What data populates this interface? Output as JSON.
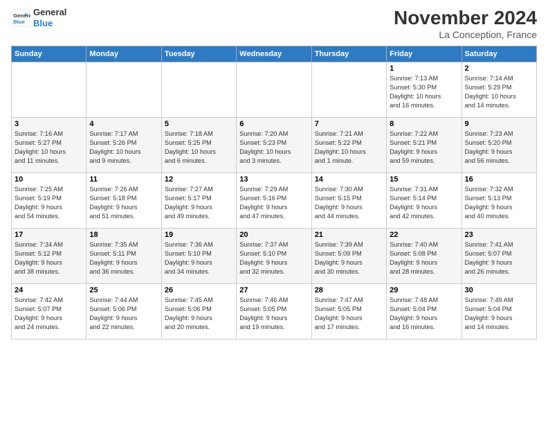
{
  "logo": {
    "line1": "General",
    "line2": "Blue"
  },
  "title": "November 2024",
  "location": "La Conception, France",
  "days_of_week": [
    "Sunday",
    "Monday",
    "Tuesday",
    "Wednesday",
    "Thursday",
    "Friday",
    "Saturday"
  ],
  "weeks": [
    [
      {
        "day": "",
        "info": ""
      },
      {
        "day": "",
        "info": ""
      },
      {
        "day": "",
        "info": ""
      },
      {
        "day": "",
        "info": ""
      },
      {
        "day": "",
        "info": ""
      },
      {
        "day": "1",
        "info": "Sunrise: 7:13 AM\nSunset: 5:30 PM\nDaylight: 10 hours\nand 16 minutes."
      },
      {
        "day": "2",
        "info": "Sunrise: 7:14 AM\nSunset: 5:29 PM\nDaylight: 10 hours\nand 14 minutes."
      }
    ],
    [
      {
        "day": "3",
        "info": "Sunrise: 7:16 AM\nSunset: 5:27 PM\nDaylight: 10 hours\nand 11 minutes."
      },
      {
        "day": "4",
        "info": "Sunrise: 7:17 AM\nSunset: 5:26 PM\nDaylight: 10 hours\nand 9 minutes."
      },
      {
        "day": "5",
        "info": "Sunrise: 7:18 AM\nSunset: 5:25 PM\nDaylight: 10 hours\nand 6 minutes."
      },
      {
        "day": "6",
        "info": "Sunrise: 7:20 AM\nSunset: 5:23 PM\nDaylight: 10 hours\nand 3 minutes."
      },
      {
        "day": "7",
        "info": "Sunrise: 7:21 AM\nSunset: 5:22 PM\nDaylight: 10 hours\nand 1 minute."
      },
      {
        "day": "8",
        "info": "Sunrise: 7:22 AM\nSunset: 5:21 PM\nDaylight: 9 hours\nand 59 minutes."
      },
      {
        "day": "9",
        "info": "Sunrise: 7:23 AM\nSunset: 5:20 PM\nDaylight: 9 hours\nand 56 minutes."
      }
    ],
    [
      {
        "day": "10",
        "info": "Sunrise: 7:25 AM\nSunset: 5:19 PM\nDaylight: 9 hours\nand 54 minutes."
      },
      {
        "day": "11",
        "info": "Sunrise: 7:26 AM\nSunset: 5:18 PM\nDaylight: 9 hours\nand 51 minutes."
      },
      {
        "day": "12",
        "info": "Sunrise: 7:27 AM\nSunset: 5:17 PM\nDaylight: 9 hours\nand 49 minutes."
      },
      {
        "day": "13",
        "info": "Sunrise: 7:29 AM\nSunset: 5:16 PM\nDaylight: 9 hours\nand 47 minutes."
      },
      {
        "day": "14",
        "info": "Sunrise: 7:30 AM\nSunset: 5:15 PM\nDaylight: 9 hours\nand 44 minutes."
      },
      {
        "day": "15",
        "info": "Sunrise: 7:31 AM\nSunset: 5:14 PM\nDaylight: 9 hours\nand 42 minutes."
      },
      {
        "day": "16",
        "info": "Sunrise: 7:32 AM\nSunset: 5:13 PM\nDaylight: 9 hours\nand 40 minutes."
      }
    ],
    [
      {
        "day": "17",
        "info": "Sunrise: 7:34 AM\nSunset: 5:12 PM\nDaylight: 9 hours\nand 38 minutes."
      },
      {
        "day": "18",
        "info": "Sunrise: 7:35 AM\nSunset: 5:11 PM\nDaylight: 9 hours\nand 36 minutes."
      },
      {
        "day": "19",
        "info": "Sunrise: 7:36 AM\nSunset: 5:10 PM\nDaylight: 9 hours\nand 34 minutes."
      },
      {
        "day": "20",
        "info": "Sunrise: 7:37 AM\nSunset: 5:10 PM\nDaylight: 9 hours\nand 32 minutes."
      },
      {
        "day": "21",
        "info": "Sunrise: 7:39 AM\nSunset: 5:09 PM\nDaylight: 9 hours\nand 30 minutes."
      },
      {
        "day": "22",
        "info": "Sunrise: 7:40 AM\nSunset: 5:08 PM\nDaylight: 9 hours\nand 28 minutes."
      },
      {
        "day": "23",
        "info": "Sunrise: 7:41 AM\nSunset: 5:07 PM\nDaylight: 9 hours\nand 26 minutes."
      }
    ],
    [
      {
        "day": "24",
        "info": "Sunrise: 7:42 AM\nSunset: 5:07 PM\nDaylight: 9 hours\nand 24 minutes."
      },
      {
        "day": "25",
        "info": "Sunrise: 7:44 AM\nSunset: 5:06 PM\nDaylight: 9 hours\nand 22 minutes."
      },
      {
        "day": "26",
        "info": "Sunrise: 7:45 AM\nSunset: 5:06 PM\nDaylight: 9 hours\nand 20 minutes."
      },
      {
        "day": "27",
        "info": "Sunrise: 7:46 AM\nSunset: 5:05 PM\nDaylight: 9 hours\nand 19 minutes."
      },
      {
        "day": "28",
        "info": "Sunrise: 7:47 AM\nSunset: 5:05 PM\nDaylight: 9 hours\nand 17 minutes."
      },
      {
        "day": "29",
        "info": "Sunrise: 7:48 AM\nSunset: 5:04 PM\nDaylight: 9 hours\nand 16 minutes."
      },
      {
        "day": "30",
        "info": "Sunrise: 7:49 AM\nSunset: 5:04 PM\nDaylight: 9 hours\nand 14 minutes."
      }
    ]
  ]
}
